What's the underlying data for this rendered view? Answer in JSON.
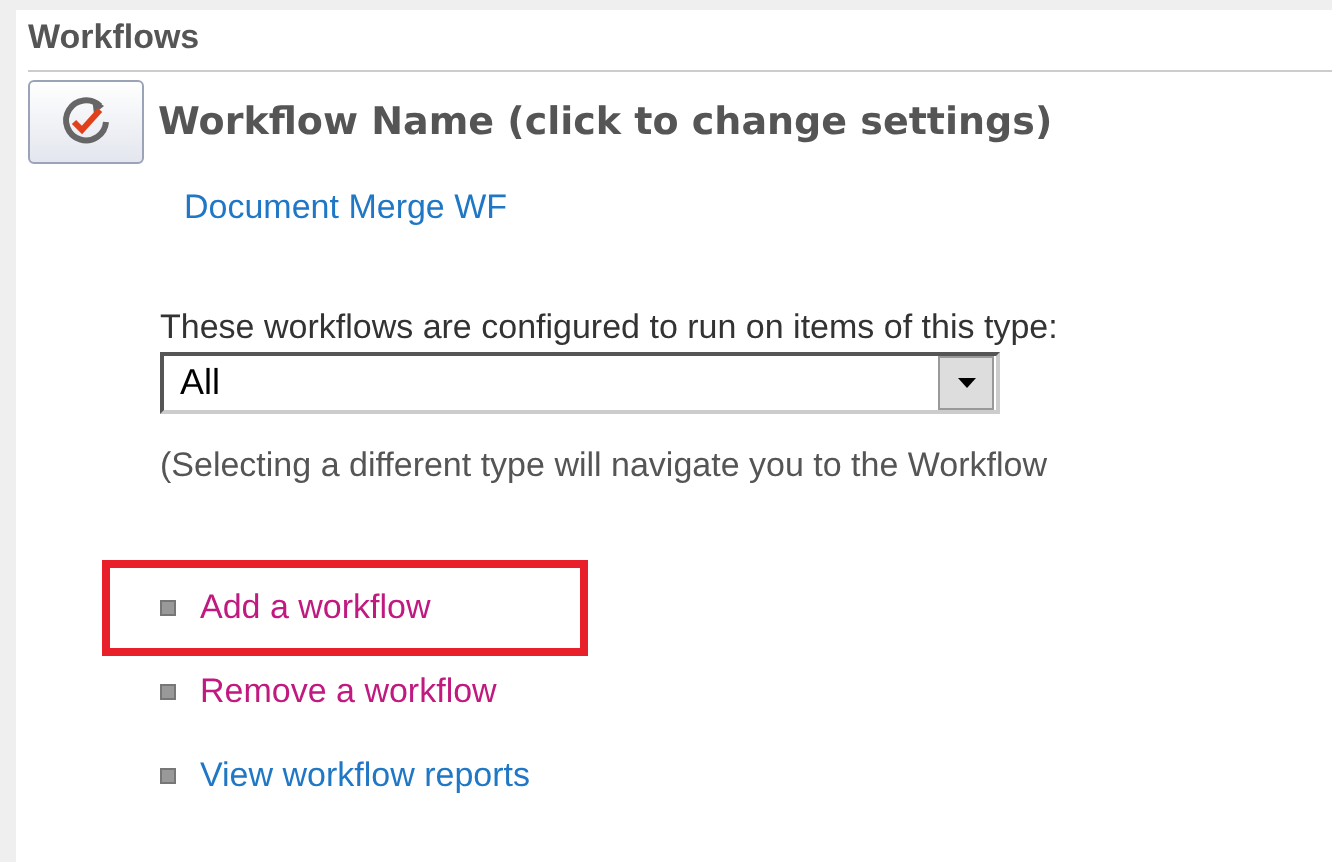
{
  "section": {
    "title": "Workflows"
  },
  "workflow_name": {
    "heading": "Workflow Name (click to change settings)",
    "link": "Document Merge WF"
  },
  "type_filter": {
    "label": "These workflows are configured to run on items of this type:",
    "value": "All",
    "note": "(Selecting a different type will navigate you to the Workflow"
  },
  "actions": [
    {
      "label": "Add a workflow",
      "visited": true,
      "highlighted": true
    },
    {
      "label": "Remove a workflow",
      "visited": true,
      "highlighted": false
    },
    {
      "label": "View workflow reports",
      "visited": false,
      "highlighted": false
    }
  ]
}
